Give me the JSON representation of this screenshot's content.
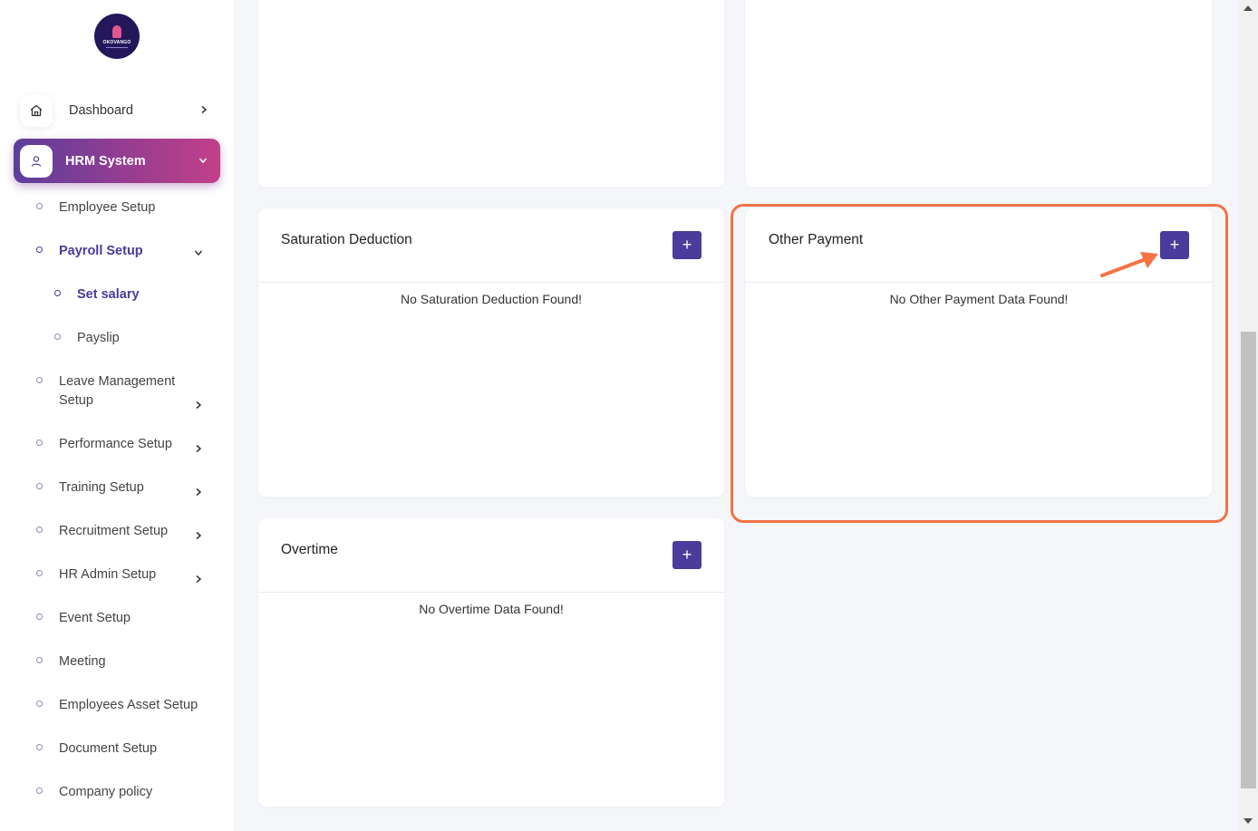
{
  "logo": {
    "text": "OKOVANGO"
  },
  "sidebar": {
    "top_item": {
      "label": "Dashboard",
      "icon": "home-icon"
    },
    "active_item": {
      "label": "HRM System",
      "icon": "user-icon"
    },
    "items": [
      {
        "label": "Employee Setup"
      },
      {
        "label": "Payroll Setup"
      },
      {
        "label": "Set salary"
      },
      {
        "label": "Payslip"
      },
      {
        "label": "Leave Management Setup"
      },
      {
        "label": "Performance Setup"
      },
      {
        "label": "Training Setup"
      },
      {
        "label": "Recruitment Setup"
      },
      {
        "label": "HR Admin Setup"
      },
      {
        "label": "Event Setup"
      },
      {
        "label": "Meeting"
      },
      {
        "label": "Employees Asset Setup"
      },
      {
        "label": "Document Setup"
      },
      {
        "label": "Company policy"
      }
    ]
  },
  "cards": {
    "saturation": {
      "title": "Saturation Deduction",
      "add": "+",
      "empty": "No Saturation Deduction Found!"
    },
    "other_payment": {
      "title": "Other Payment",
      "add": "+",
      "empty": "No Other Payment Data Found!"
    },
    "overtime": {
      "title": "Overtime",
      "add": "+",
      "empty": "No Overtime Data Found!"
    }
  },
  "colors": {
    "accent": "#4b3b9a",
    "highlight": "#f47244",
    "active_gradient_start": "#5b3e9e",
    "active_gradient_end": "#c2408a"
  }
}
